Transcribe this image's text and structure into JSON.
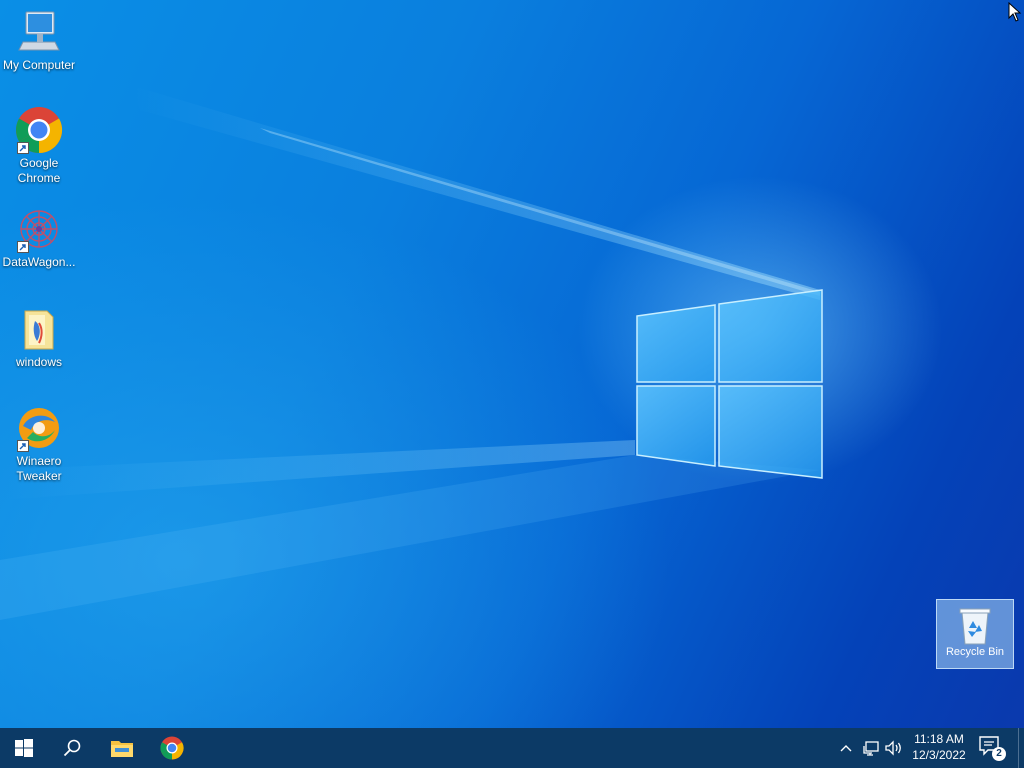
{
  "desktop": {
    "icons": [
      {
        "label": "My Computer",
        "icon": "computer-icon"
      },
      {
        "label": "Google Chrome",
        "icon": "chrome-icon"
      },
      {
        "label": "DataWagon...",
        "icon": "datawagon-icon"
      },
      {
        "label": "windows",
        "icon": "folder-icon"
      },
      {
        "label": "Winaero Tweaker",
        "icon": "winaero-tweaker-icon"
      }
    ],
    "recycle_bin": {
      "label": "Recycle Bin",
      "icon": "recycle-bin-icon"
    }
  },
  "taskbar": {
    "start_icon": "windows-start-icon",
    "search_icon": "search-icon",
    "pinned": [
      {
        "name": "File Explorer",
        "icon": "file-explorer-icon"
      },
      {
        "name": "Google Chrome",
        "icon": "chrome-icon"
      }
    ],
    "tray": {
      "chevron_icon": "chevron-up-icon",
      "network_icon": "network-icon",
      "volume_icon": "volume-icon"
    },
    "clock": {
      "time": "11:18 AM",
      "date": "12/3/2022"
    },
    "notifications": {
      "icon": "action-center-icon",
      "count": "2"
    }
  },
  "colors": {
    "taskbar": "#0c3a66",
    "wallpaper_primary": "#0a7fde",
    "wallpaper_dark": "#0442b8"
  }
}
